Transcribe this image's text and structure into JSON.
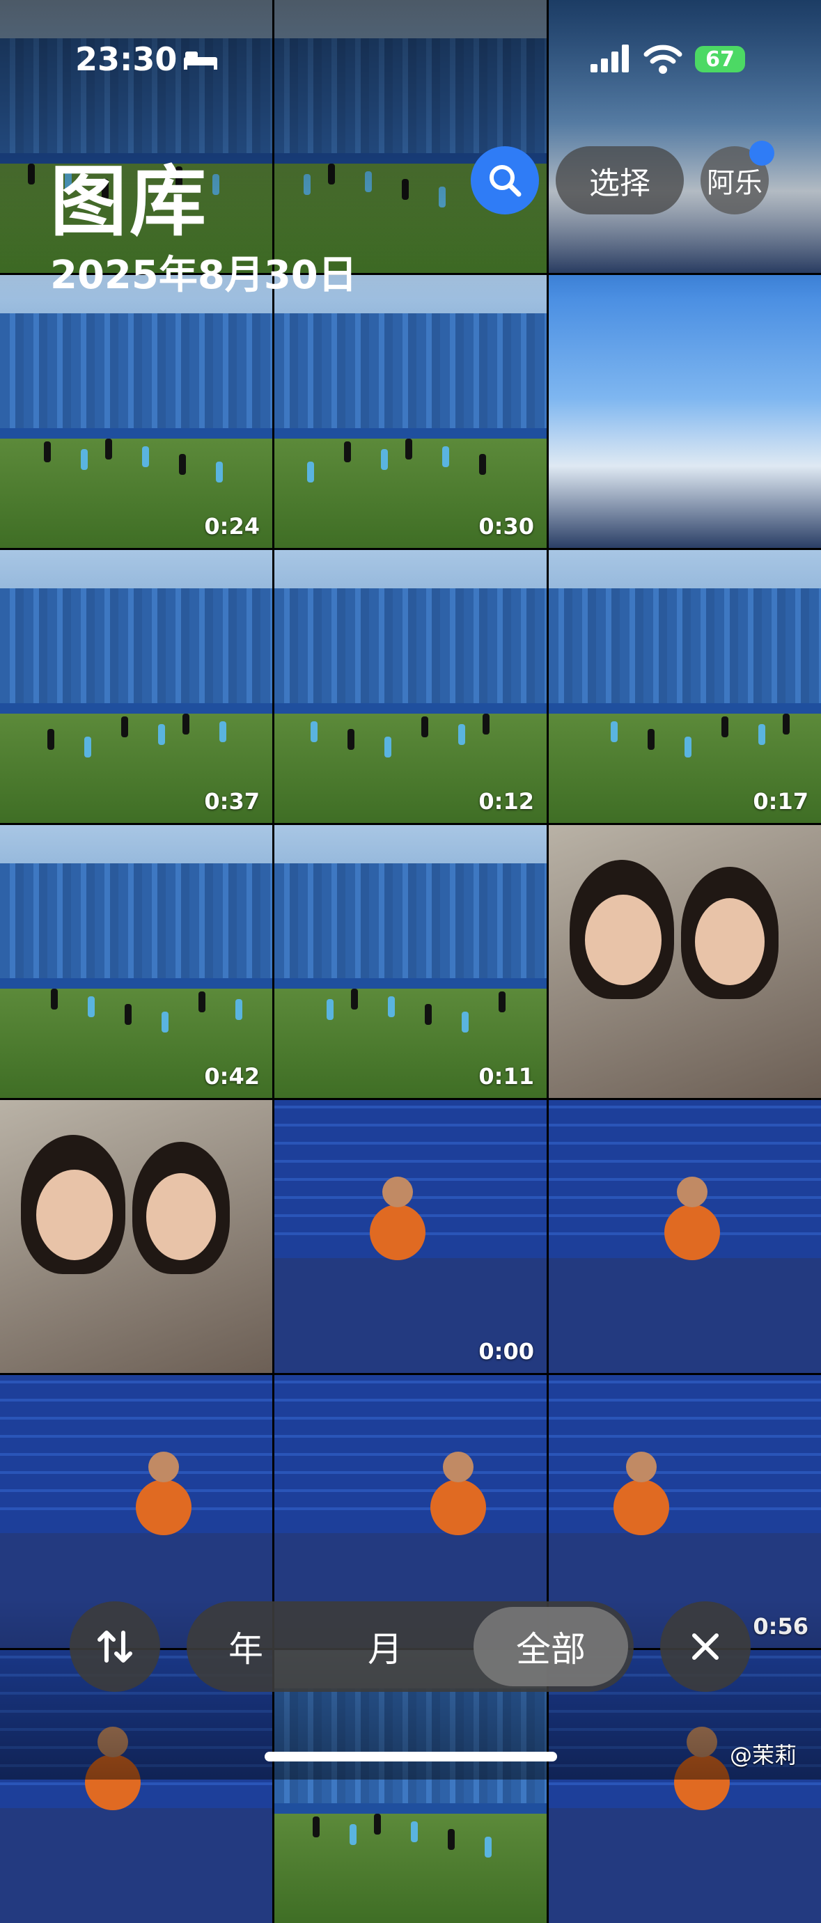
{
  "status_bar": {
    "time": "23:30",
    "battery": "67"
  },
  "header": {
    "title": "图库",
    "date": "2025年8月30日",
    "select_label": "选择",
    "avatar_label": "阿乐"
  },
  "tiles": [
    {
      "kind": "stadium",
      "duration": ""
    },
    {
      "kind": "stadium",
      "duration": ""
    },
    {
      "kind": "sky",
      "duration": ""
    },
    {
      "kind": "stadium",
      "duration": "0:24"
    },
    {
      "kind": "stadium",
      "duration": "0:30"
    },
    {
      "kind": "sky",
      "duration": ""
    },
    {
      "kind": "stadium",
      "duration": "0:37"
    },
    {
      "kind": "stadium",
      "duration": "0:12"
    },
    {
      "kind": "stadium",
      "duration": "0:17"
    },
    {
      "kind": "stadium",
      "duration": "0:42"
    },
    {
      "kind": "stadium",
      "duration": "0:11"
    },
    {
      "kind": "selfie",
      "duration": ""
    },
    {
      "kind": "selfie",
      "duration": ""
    },
    {
      "kind": "press",
      "duration": "0:00"
    },
    {
      "kind": "press",
      "duration": ""
    },
    {
      "kind": "press",
      "duration": ""
    },
    {
      "kind": "press",
      "duration": ""
    },
    {
      "kind": "press",
      "duration": "0:56"
    },
    {
      "kind": "press",
      "duration": ""
    },
    {
      "kind": "stadium",
      "duration": ""
    },
    {
      "kind": "press",
      "duration": ""
    }
  ],
  "bottom_bar": {
    "year": "年",
    "month": "月",
    "all": "全部"
  },
  "watermark": "@茉莉",
  "colors": {
    "accent": "#2f7cf6",
    "battery": "#4cd964"
  }
}
